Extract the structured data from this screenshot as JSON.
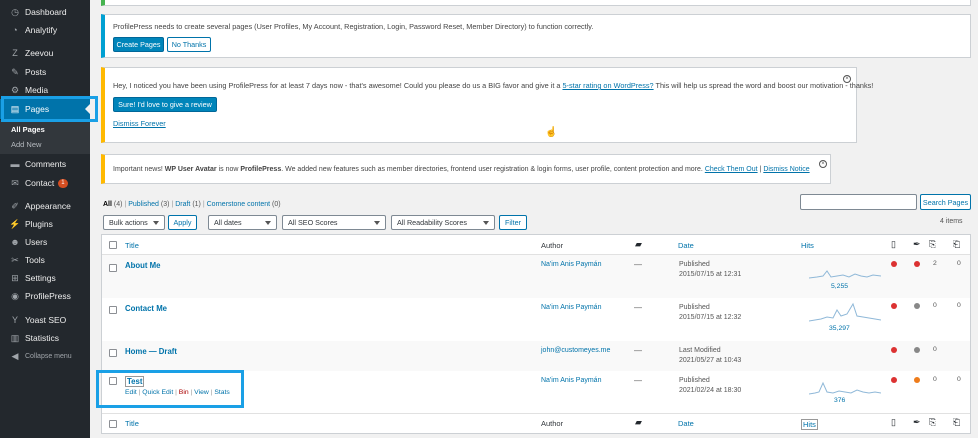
{
  "sidebar": {
    "items": [
      {
        "label": "Dashboard",
        "icon": "dashboard-icon"
      },
      {
        "label": "Analytify",
        "icon": "analytify-icon"
      },
      {
        "label": "Zeevou",
        "icon": "zeevou-icon"
      },
      {
        "label": "Posts",
        "icon": "pin-icon"
      },
      {
        "label": "Media",
        "icon": "media-icon"
      },
      {
        "label": "Pages",
        "icon": "pages-icon"
      },
      {
        "label": "Comments",
        "icon": "comments-icon"
      },
      {
        "label": "Contact",
        "icon": "envelope-icon",
        "badge": "1"
      },
      {
        "label": "Appearance",
        "icon": "brush-icon"
      },
      {
        "label": "Plugins",
        "icon": "plug-icon"
      },
      {
        "label": "Users",
        "icon": "users-icon"
      },
      {
        "label": "Tools",
        "icon": "wrench-icon"
      },
      {
        "label": "Settings",
        "icon": "settings-icon"
      },
      {
        "label": "ProfilePress",
        "icon": "profilepress-icon"
      },
      {
        "label": "Yoast SEO",
        "icon": "yoast-icon"
      },
      {
        "label": "Statistics",
        "icon": "statistics-icon"
      },
      {
        "label": "Collapse menu",
        "icon": "collapse-icon"
      }
    ],
    "pages_sub": [
      "All Pages",
      "Add New"
    ]
  },
  "notices": {
    "profilepress": {
      "text": "ProfilePress needs to create several pages (User Profiles, My Account, Registration, Login, Password Reset, Member Directory) to function correctly.",
      "create": "Create Pages",
      "nothanks": "No Thanks"
    },
    "review": {
      "text_before": "Hey, I noticed you have been using ProfilePress for at least 7 days now - that's awesome! Could you please do us a BIG favor and give it a ",
      "link": "5-star rating on WordPress?",
      "text_after": " This will help us spread the word and boost our motivation - thanks!",
      "button": "Sure! I'd love to give a review",
      "dismiss": "Dismiss Forever"
    },
    "avatar": {
      "p1": "Important news! ",
      "b1": "WP User Avatar",
      "p2": " is now ",
      "b2": "ProfilePress",
      "p3": ". We added new features such as member directories, frontend user registration & login forms, user profile, content protection and more. ",
      "link1": "Check Them Out",
      "sep": " | ",
      "link2": "Dismiss Notice"
    }
  },
  "filters": {
    "all": "All",
    "all_count": "(4)",
    "published": "Published",
    "published_count": "(3)",
    "draft": "Draft",
    "draft_count": "(1)",
    "cornerstone": "Cornerstone content",
    "cornerstone_count": "(0)",
    "bulk": "Bulk actions",
    "apply": "Apply",
    "dates": "All dates",
    "seo": "All SEO Scores",
    "readability": "All Readability Scores",
    "filter": "Filter",
    "search_button": "Search Pages",
    "items": "4 items"
  },
  "table": {
    "headers": {
      "title": "Title",
      "author": "Author",
      "date": "Date",
      "hits": "Hits"
    },
    "rows": [
      {
        "title": "About Me",
        "author": "Na'im Anis Paymán",
        "comments": "—",
        "status": "Published",
        "date": "2015/07/15 at 12:31",
        "hits": "5,255",
        "c1": "2",
        "c2": "0"
      },
      {
        "title": "Contact Me",
        "author": "Na'im Anis Paymán",
        "comments": "—",
        "status": "Published",
        "date": "2015/07/15 at 12:32",
        "hits": "35,297",
        "c1": "0",
        "c2": "0"
      },
      {
        "title": "Home — Draft",
        "author": "john@customeyes.me",
        "comments": "—",
        "status": "Last Modified",
        "date": "2021/05/27 at 10:43",
        "hits": "",
        "c1": "0",
        "c2": ""
      },
      {
        "title": "Test",
        "author": "Na'im Anis Paymán",
        "comments": "—",
        "status": "Published",
        "date": "2021/02/24 at 18:30",
        "hits": "376",
        "c1": "0",
        "c2": "0"
      }
    ],
    "row_actions": {
      "edit": "Edit",
      "quick": "Quick Edit",
      "bin": "Bin",
      "view": "View",
      "stats": "Stats"
    }
  },
  "colors": {
    "accent": "#0073aa",
    "sidebar": "#23282d",
    "highlight": "#1aa0e6",
    "seo_red": "#dc3232",
    "seo_orange": "#ee7c1b",
    "seo_grey": "#888888"
  }
}
